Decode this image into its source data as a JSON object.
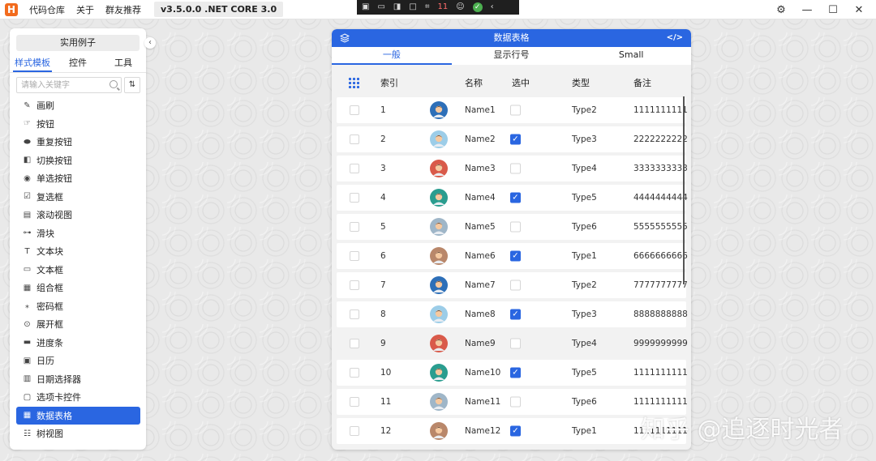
{
  "titlebar": {
    "logo": "H",
    "menus": [
      "代码仓库",
      "关于",
      "群友推荐"
    ],
    "version": "v3.5.0.0 .NET CORE 3.0",
    "capture_count": "11"
  },
  "left_panel": {
    "examples_button": "实用例子",
    "tabs": [
      "样式模板",
      "控件",
      "工具"
    ],
    "search_placeholder": "请输入关键字",
    "items": [
      {
        "label": "画刷",
        "icon": "brush-icon"
      },
      {
        "label": "按钮",
        "icon": "cursor-icon"
      },
      {
        "label": "重复按钮",
        "icon": "pill-icon"
      },
      {
        "label": "切换按钮",
        "icon": "toggle-icon"
      },
      {
        "label": "单选按钮",
        "icon": "radio-icon"
      },
      {
        "label": "复选框",
        "icon": "checkbox-icon"
      },
      {
        "label": "滚动视图",
        "icon": "scroll-icon"
      },
      {
        "label": "滑块",
        "icon": "slider-icon"
      },
      {
        "label": "文本块",
        "icon": "textblock-icon"
      },
      {
        "label": "文本框",
        "icon": "textbox-icon"
      },
      {
        "label": "组合框",
        "icon": "combobox-icon"
      },
      {
        "label": "密码框",
        "icon": "password-icon"
      },
      {
        "label": "展开框",
        "icon": "expander-icon"
      },
      {
        "label": "进度条",
        "icon": "progress-icon"
      },
      {
        "label": "日历",
        "icon": "calendar-icon"
      },
      {
        "label": "日期选择器",
        "icon": "datepicker-icon"
      },
      {
        "label": "选项卡控件",
        "icon": "tab-icon"
      },
      {
        "label": "数据表格",
        "icon": "datagrid-icon"
      },
      {
        "label": "树视图",
        "icon": "tree-icon"
      }
    ],
    "active_index": 17
  },
  "data_window": {
    "title": "数据表格",
    "tabs": [
      "一般",
      "显示行号",
      "Small"
    ],
    "columns": {
      "index": "索引",
      "name": "名称",
      "selected": "选中",
      "type": "类型",
      "note": "备注"
    },
    "rows": [
      {
        "index": "1",
        "name": "Name1",
        "selected": false,
        "type": "Type2",
        "note": "1111111111",
        "avatar": "#2d6fb8"
      },
      {
        "index": "2",
        "name": "Name2",
        "selected": true,
        "type": "Type3",
        "note": "2222222222",
        "avatar": "#9ccde8"
      },
      {
        "index": "3",
        "name": "Name3",
        "selected": false,
        "type": "Type4",
        "note": "3333333333",
        "avatar": "#d95a4a"
      },
      {
        "index": "4",
        "name": "Name4",
        "selected": true,
        "type": "Type5",
        "note": "4444444444",
        "avatar": "#2a9d8f"
      },
      {
        "index": "5",
        "name": "Name5",
        "selected": false,
        "type": "Type6",
        "note": "5555555555",
        "avatar": "#9fb6c8"
      },
      {
        "index": "6",
        "name": "Name6",
        "selected": true,
        "type": "Type1",
        "note": "6666666666",
        "avatar": "#b9876a"
      },
      {
        "index": "7",
        "name": "Name7",
        "selected": false,
        "type": "Type2",
        "note": "7777777777",
        "avatar": "#2d6fb8"
      },
      {
        "index": "8",
        "name": "Name8",
        "selected": true,
        "type": "Type3",
        "note": "8888888888",
        "avatar": "#9ccde8"
      },
      {
        "index": "9",
        "name": "Name9",
        "selected": false,
        "type": "Type4",
        "note": "9999999999",
        "avatar": "#d95a4a"
      },
      {
        "index": "10",
        "name": "Name10",
        "selected": true,
        "type": "Type5",
        "note": "1111111111",
        "avatar": "#2a9d8f"
      },
      {
        "index": "11",
        "name": "Name11",
        "selected": false,
        "type": "Type6",
        "note": "1111111111",
        "avatar": "#9fb6c8"
      },
      {
        "index": "12",
        "name": "Name12",
        "selected": true,
        "type": "Type1",
        "note": "1111111111",
        "avatar": "#b9876a"
      }
    ],
    "highlighted_row_index": 8
  },
  "watermark": "知乎 @追逐时光者",
  "colors": {
    "accent": "#2a66e1",
    "logo": "#f26b1d"
  }
}
